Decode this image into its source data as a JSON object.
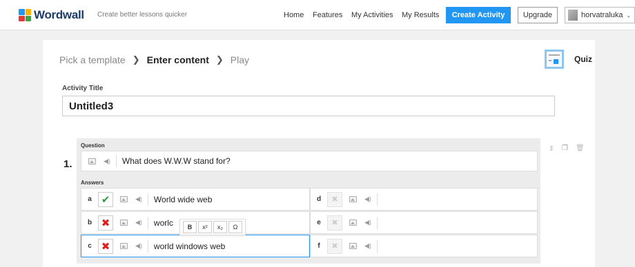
{
  "header": {
    "brand": "Wordwall",
    "tagline": "Create better lessons quicker",
    "nav": [
      {
        "label": "Home"
      },
      {
        "label": "Features"
      },
      {
        "label": "My Activities"
      },
      {
        "label": "My Results"
      }
    ],
    "create_label": "Create Activity",
    "upgrade_label": "Upgrade",
    "username": "horvatraluka",
    "dropdown_icon": "chevron-down-icon"
  },
  "steps": {
    "step1": "Pick a template",
    "step2": "Enter content",
    "step3": "Play",
    "separator": "❯"
  },
  "template": {
    "name": "Quiz"
  },
  "activity": {
    "title_label": "Activity Title",
    "title_value": "Untitled3"
  },
  "question": {
    "number": "1.",
    "label": "Question",
    "text": "What does W.W.W stand for?",
    "answers_label": "Answers"
  },
  "answers": [
    {
      "letter": "a",
      "text": "World wide web",
      "state": "correct"
    },
    {
      "letter": "b",
      "text": "worlc",
      "state": "incorrect"
    },
    {
      "letter": "c",
      "text": "world windows web",
      "state": "incorrect"
    },
    {
      "letter": "d",
      "text": "",
      "state": "disabled"
    },
    {
      "letter": "e",
      "text": "",
      "state": "disabled"
    },
    {
      "letter": "f",
      "text": "",
      "state": "disabled"
    }
  ],
  "format_toolbar": {
    "bold": "B",
    "superscript": "x²",
    "subscript": "x₂",
    "symbol": "Ω"
  },
  "colors": {
    "accent": "#2196f3",
    "correct": "#2e9b3c",
    "incorrect": "#e02020",
    "brand": "#1d3b6b"
  }
}
